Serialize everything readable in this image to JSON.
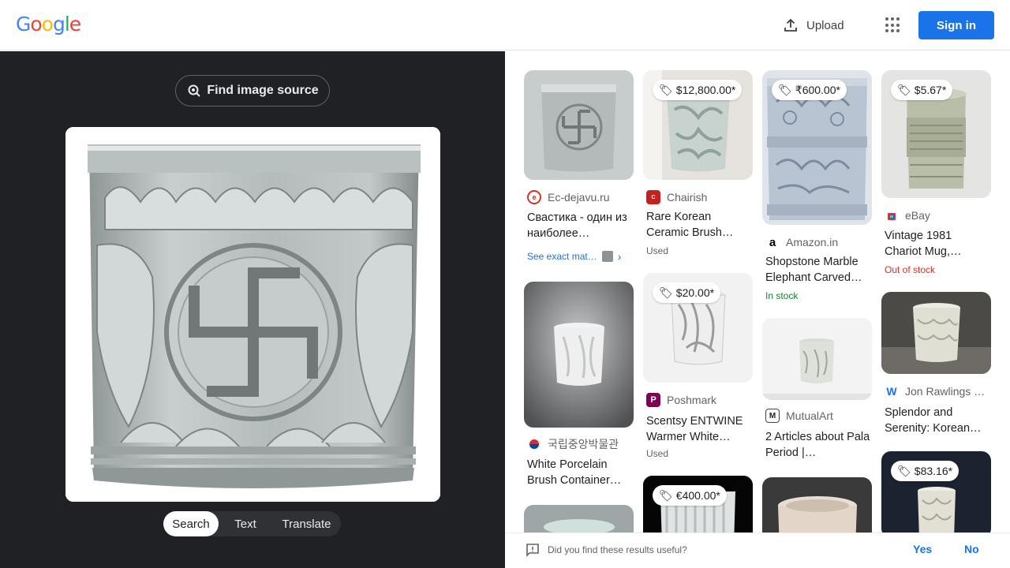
{
  "header": {
    "logo_letters": [
      {
        "ch": "G",
        "color": "#4285F4"
      },
      {
        "ch": "o",
        "color": "#EA4335"
      },
      {
        "ch": "o",
        "color": "#FBBC05"
      },
      {
        "ch": "g",
        "color": "#4285F4"
      },
      {
        "ch": "l",
        "color": "#34A853"
      },
      {
        "ch": "e",
        "color": "#EA4335"
      }
    ],
    "upload_label": "Upload",
    "apps_icon": "apps-grid-icon",
    "signin_label": "Sign in"
  },
  "left": {
    "find_source_label": "Find image source",
    "modes": [
      {
        "label": "Search",
        "active": true
      },
      {
        "label": "Text",
        "active": false
      },
      {
        "label": "Translate",
        "active": false
      }
    ]
  },
  "results": [
    {
      "source": "Ec-dejavu.ru",
      "favicon_color": "#d93025",
      "favicon_char": "e",
      "title": "Свастика - один из наиболее…",
      "exact": "See exact mat…",
      "img": "jar1"
    },
    {
      "source": "Chairish",
      "favicon_color": "#c5221f",
      "favicon_char": "c",
      "price": "$12,800.00*",
      "title": "Rare Korean Ceramic Brush…",
      "meta": "Used",
      "meta_color": "#5f6368",
      "img": "jar2"
    },
    {
      "source": "Amazon.in",
      "favicon_color": "#ffffff",
      "favicon_char": "a",
      "price": "₹600.00*",
      "title": "Shopstone Marble Elephant Carved…",
      "meta": "In stock",
      "meta_color": "#188038",
      "img": "jar3"
    },
    {
      "source": "eBay",
      "favicon_color": "#ffffff",
      "favicon_char": "e",
      "price": "$5.67*",
      "title": "Vintage 1981 Chariot Mug,…",
      "meta": "Out of stock",
      "meta_color": "#d93025",
      "img": "jar4"
    },
    {
      "source": "국립중앙박물관",
      "favicon_color": "#ffffff",
      "favicon_char": "",
      "title": "White Porcelain Brush Container…",
      "img": "jar5"
    },
    {
      "source": "Poshmark",
      "favicon_color": "#7f0353",
      "favicon_char": "P",
      "price": "$20.00*",
      "title": "Scentsy ENTWINE Warmer White…",
      "meta": "Used",
      "meta_color": "#5f6368",
      "img": "jar6"
    },
    {
      "source": "MutualArt",
      "favicon_color": "#ffffff",
      "favicon_char": "M",
      "title": "2 Articles about Pala Period |…",
      "img": "jar7"
    },
    {
      "source": "Jon Rawlings …",
      "favicon_color": "#ffffff",
      "favicon_char": "W",
      "title": "Splendor and Serenity: Korean…",
      "img": "jar8"
    },
    {
      "price": "€400.00*",
      "img": "jar9"
    },
    {
      "price": "$83.16*",
      "img": "jar10"
    }
  ],
  "feedback": {
    "question": "Did you find these results useful?",
    "yes": "Yes",
    "no": "No"
  }
}
